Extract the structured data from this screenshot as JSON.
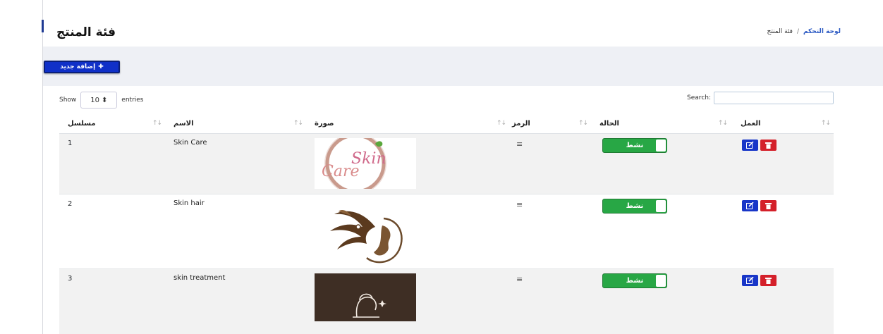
{
  "header": {
    "title": "فئة المنتج",
    "breadcrumb": {
      "home": "لوحة التحكم",
      "separator": "/",
      "current": "فئة المنتج"
    }
  },
  "toolbar": {
    "add_label": "إضافة جديد"
  },
  "table_controls": {
    "show_label": "Show",
    "entries_value": "10",
    "entries_label": "entries",
    "search_label": "Search:",
    "search_value": ""
  },
  "table": {
    "columns": [
      "مسلسل",
      "الاسم",
      "صورة",
      "الرمز",
      "الحالة",
      "العمل"
    ],
    "rows": [
      {
        "serial": "1",
        "name": "Skin Care",
        "image": "Skin Care",
        "code_icon": "hamburger-icon",
        "status": "نشط"
      },
      {
        "serial": "2",
        "name": "Skin hair",
        "image": "",
        "code_icon": "hamburger-icon",
        "status": "نشط"
      },
      {
        "serial": "3",
        "name": "skin treatment",
        "image": "",
        "code_icon": "hamburger-icon",
        "status": "نشط"
      }
    ]
  },
  "colors": {
    "primary": "#1030c8",
    "success": "#28a745",
    "danger": "#d4202a",
    "link": "#2b59c3"
  }
}
